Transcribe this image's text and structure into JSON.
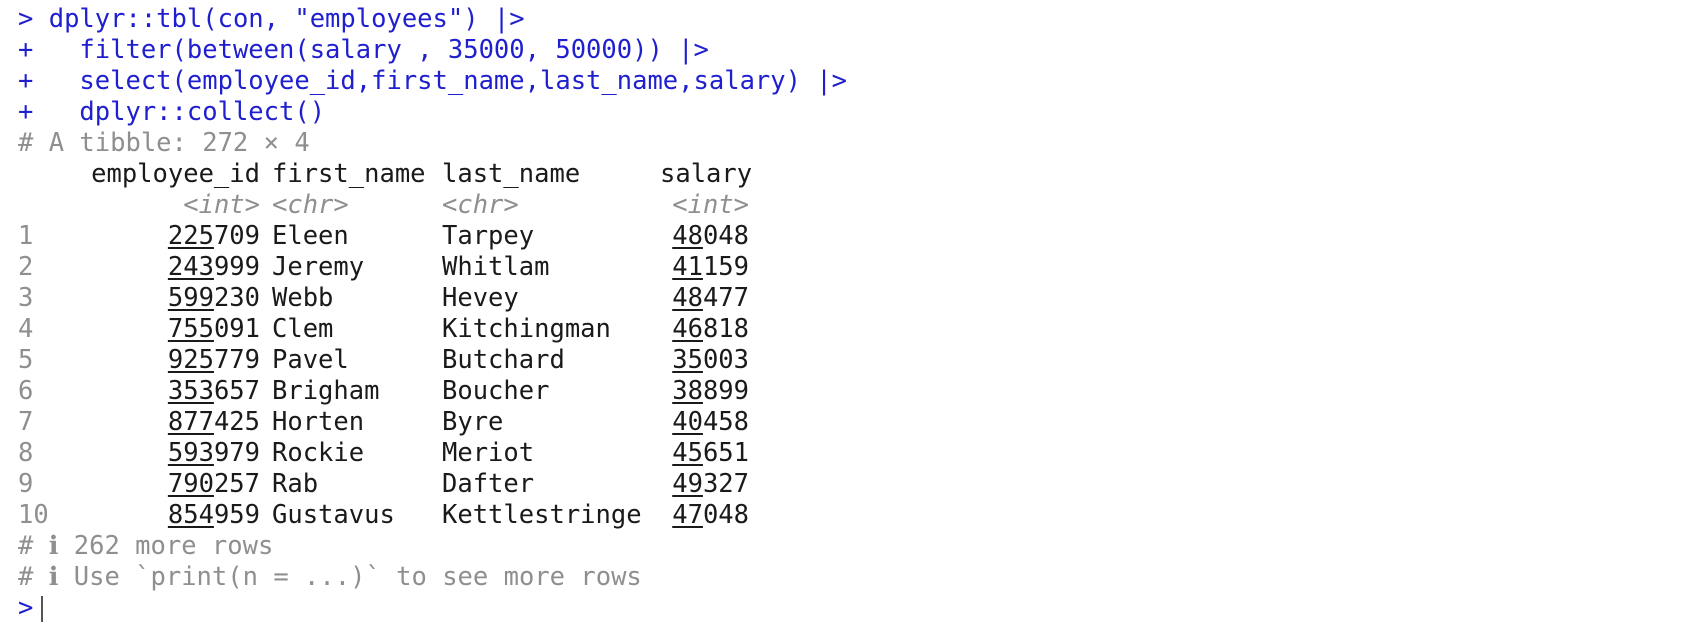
{
  "console": {
    "prompt": ">",
    "continuation": "+",
    "command_lines": [
      "dplyr::tbl(con, \"employees\") |>",
      "  filter(between(salary , 35000, 50000)) |>",
      "  select(employee_id,first_name,last_name,salary) |>",
      "  dplyr::collect()"
    ],
    "tibble_header": "# A tibble: 272 × 4",
    "columns": [
      {
        "name": "employee_id",
        "type": "<int>"
      },
      {
        "name": "first_name",
        "type": "<chr>"
      },
      {
        "name": "last_name",
        "type": "<chr>"
      },
      {
        "name": "salary",
        "type": "<int>"
      }
    ],
    "rows": [
      {
        "n": "1",
        "id_u": "225",
        "id_r": "709",
        "first": "Eleen",
        "last": "Tarpey",
        "sal_u": "48",
        "sal_r": "048"
      },
      {
        "n": "2",
        "id_u": "243",
        "id_r": "999",
        "first": "Jeremy",
        "last": "Whitlam",
        "sal_u": "41",
        "sal_r": "159"
      },
      {
        "n": "3",
        "id_u": "599",
        "id_r": "230",
        "first": "Webb",
        "last": "Hevey",
        "sal_u": "48",
        "sal_r": "477"
      },
      {
        "n": "4",
        "id_u": "755",
        "id_r": "091",
        "first": "Clem",
        "last": "Kitchingman",
        "sal_u": "46",
        "sal_r": "818"
      },
      {
        "n": "5",
        "id_u": "925",
        "id_r": "779",
        "first": "Pavel",
        "last": "Butchard",
        "sal_u": "35",
        "sal_r": "003"
      },
      {
        "n": "6",
        "id_u": "353",
        "id_r": "657",
        "first": "Brigham",
        "last": "Boucher",
        "sal_u": "38",
        "sal_r": "899"
      },
      {
        "n": "7",
        "id_u": "877",
        "id_r": "425",
        "first": "Horten",
        "last": "Byre",
        "sal_u": "40",
        "sal_r": "458"
      },
      {
        "n": "8",
        "id_u": "593",
        "id_r": "979",
        "first": "Rockie",
        "last": "Meriot",
        "sal_u": "45",
        "sal_r": "651"
      },
      {
        "n": "9",
        "id_u": "790",
        "id_r": "257",
        "first": "Rab",
        "last": "Dafter",
        "sal_u": "49",
        "sal_r": "327"
      },
      {
        "n": "10",
        "id_u": "854",
        "id_r": "959",
        "first": "Gustavus",
        "last": "Kettlestringe",
        "sal_u": "47",
        "sal_r": "048"
      }
    ],
    "footer_lines": [
      "# ℹ 262 more rows",
      "# ℹ Use `print(n = ...)` to see more rows"
    ]
  },
  "colors": {
    "command": "#1f1fcf",
    "meta": "#8f8f8f",
    "text": "#1a1a1a"
  }
}
